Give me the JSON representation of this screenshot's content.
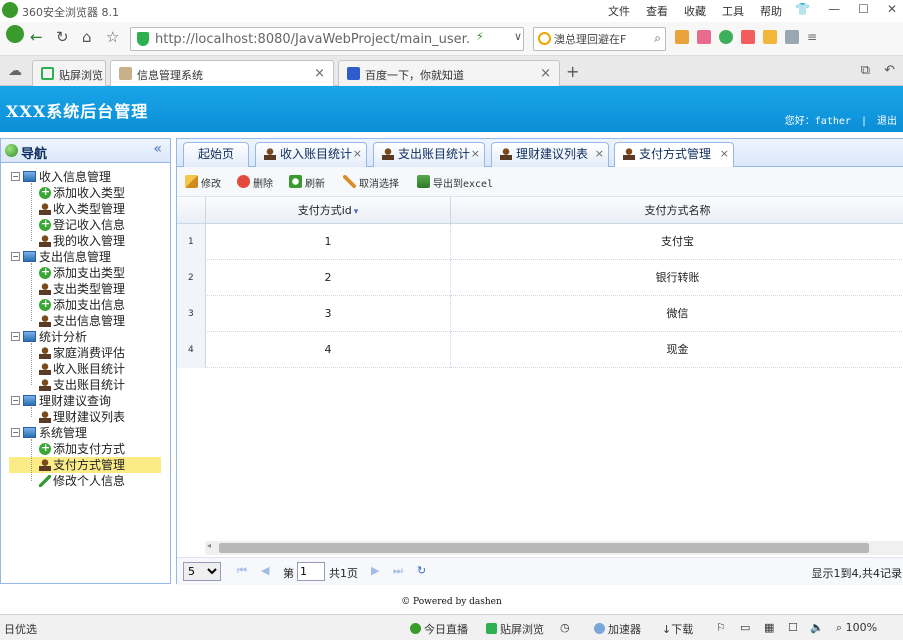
{
  "browser": {
    "title": "360安全浏览器 8.1",
    "menus": [
      "文件",
      "查看",
      "收藏",
      "工具",
      "帮助"
    ],
    "window_controls": [
      "shirt-icon",
      "minimize-icon",
      "maximize-icon",
      "close-icon"
    ],
    "address": "http://localhost:8080/JavaWebProject/main_user.",
    "search_text": "澳总理回避在F",
    "tabs": [
      {
        "label": "贴屏浏览",
        "active": false
      },
      {
        "label": "信息管理系统",
        "active": true
      },
      {
        "label": "百度一下，你就知道",
        "active": false
      }
    ]
  },
  "app": {
    "title": "XXX系统后台管理",
    "greeting": "您好：father",
    "separator": "|",
    "logout": "退出"
  },
  "nav": {
    "title": "导航",
    "collapse": "«",
    "groups": [
      {
        "label": "收入信息管理",
        "items": [
          {
            "label": "添加收入类型",
            "icon": "add"
          },
          {
            "label": "收入类型管理",
            "icon": "man"
          },
          {
            "label": "登记收入信息",
            "icon": "add"
          },
          {
            "label": "我的收入管理",
            "icon": "man"
          }
        ]
      },
      {
        "label": "支出信息管理",
        "items": [
          {
            "label": "添加支出类型",
            "icon": "add"
          },
          {
            "label": "支出类型管理",
            "icon": "man"
          },
          {
            "label": "添加支出信息",
            "icon": "add"
          },
          {
            "label": "支出信息管理",
            "icon": "man"
          }
        ]
      },
      {
        "label": "统计分析",
        "items": [
          {
            "label": "家庭消费评估",
            "icon": "man"
          },
          {
            "label": "收入账目统计",
            "icon": "man"
          },
          {
            "label": "支出账目统计",
            "icon": "man"
          }
        ]
      },
      {
        "label": "理财建议查询",
        "items": [
          {
            "label": "理财建议列表",
            "icon": "man"
          }
        ]
      },
      {
        "label": "系统管理",
        "items": [
          {
            "label": "添加支付方式",
            "icon": "add"
          },
          {
            "label": "支付方式管理",
            "icon": "man",
            "selected": true
          },
          {
            "label": "修改个人信息",
            "icon": "pen"
          }
        ]
      }
    ]
  },
  "content_tabs": [
    {
      "label": "起始页",
      "closable": false
    },
    {
      "label": "收入账目统计",
      "closable": true
    },
    {
      "label": "支出账目统计",
      "closable": true
    },
    {
      "label": "理财建议列表",
      "closable": true
    },
    {
      "label": "支付方式管理",
      "closable": true,
      "active": true
    }
  ],
  "toolbar": {
    "edit": "修改",
    "delete": "删除",
    "refresh": "刷新",
    "unselect": "取消选择",
    "export": "导出到excel"
  },
  "grid": {
    "columns": [
      "支付方式id",
      "支付方式名称"
    ],
    "sort_indicator": "▾",
    "rows": [
      {
        "num": "1",
        "id": "1",
        "name": "支付宝"
      },
      {
        "num": "2",
        "id": "2",
        "name": "银行转账"
      },
      {
        "num": "3",
        "id": "3",
        "name": "微信"
      },
      {
        "num": "4",
        "id": "4",
        "name": "现金"
      }
    ]
  },
  "pager": {
    "page_size": "5",
    "page_prefix": "第",
    "page_value": "1",
    "page_suffix": "共1页",
    "info": "显示1到4,共4记录"
  },
  "footer": "© Powered by dashen",
  "statusbar": {
    "left": "日优选",
    "items": [
      "今日直播",
      "贴屏浏览",
      "加速器",
      "下载",
      "100%"
    ]
  },
  "colors": {
    "header": "#0b8fd6",
    "panel_border": "#95b8e7",
    "selected": "#fbec88"
  }
}
